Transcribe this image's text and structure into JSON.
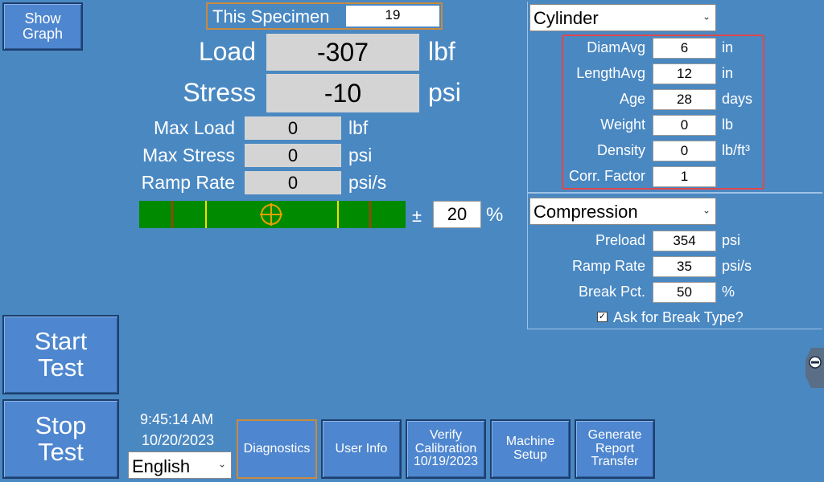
{
  "show_graph": "Show\nGraph",
  "specimen": {
    "label": "This Specimen",
    "value": "19"
  },
  "readings": {
    "load": {
      "label": "Load",
      "value": "-307",
      "unit": "lbf"
    },
    "stress": {
      "label": "Stress",
      "value": "-10",
      "unit": "psi"
    },
    "max_load": {
      "label": "Max Load",
      "value": "0",
      "unit": "lbf"
    },
    "max_stress": {
      "label": "Max Stress",
      "value": "0",
      "unit": "psi"
    },
    "ramp_rate": {
      "label": "Ramp Rate",
      "value": "0",
      "unit": "psi/s"
    }
  },
  "tolerance": {
    "prefix": "±",
    "value": "20",
    "unit": "%"
  },
  "specimen_panel": {
    "type_selected": "Cylinder",
    "fields": [
      {
        "label": "DiamAvg",
        "value": "6",
        "unit": "in"
      },
      {
        "label": "LengthAvg",
        "value": "12",
        "unit": "in"
      },
      {
        "label": "Age",
        "value": "28",
        "unit": "days"
      },
      {
        "label": "Weight",
        "value": "0",
        "unit": "lb"
      },
      {
        "label": "Density",
        "value": "0",
        "unit": "lb/ft³"
      },
      {
        "label": "Corr. Factor",
        "value": "1",
        "unit": ""
      }
    ]
  },
  "test_panel": {
    "type_selected": "Compression",
    "fields": [
      {
        "label": "Preload",
        "value": "354",
        "unit": "psi"
      },
      {
        "label": "Ramp Rate",
        "value": "35",
        "unit": "psi/s"
      },
      {
        "label": "Break Pct.",
        "value": "50",
        "unit": "%"
      }
    ],
    "ask_break_type": {
      "label": "Ask for Break Type?",
      "checked": true
    }
  },
  "buttons": {
    "start_test": "Start\nTest",
    "stop_test": "Stop\nTest",
    "diagnostics": "Diagnostics",
    "user_info": "User Info",
    "verify_calibration": "Verify\nCalibration\n10/19/2023",
    "machine_setup": "Machine\nSetup",
    "generate_report": "Generate\nReport\nTransfer"
  },
  "clock": {
    "time": "9:45:14 AM",
    "date": "10/20/2023"
  },
  "language": {
    "selected": "English"
  },
  "colors": {
    "background": "#4a88c2",
    "highlight_box": "#e0474c",
    "bar_green": "#008a00",
    "bar_yellow": "#f0e000",
    "bar_red": "#c03010",
    "crosshair": "#e8a000"
  }
}
